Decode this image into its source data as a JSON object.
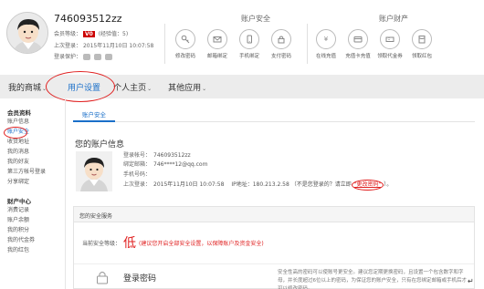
{
  "profile": {
    "username": "746093512zz",
    "level_label": "会员等级：",
    "vip": "V0",
    "exp": "(经验值：5)",
    "last_login_label": "上次登录：",
    "last_login": "2015年11月10日 10:07:58",
    "login_via_label": "登录保护："
  },
  "account_security": {
    "title": "账户安全",
    "items": [
      "修改密码",
      "邮箱绑定",
      "手机绑定",
      "支付密码"
    ]
  },
  "account_assets": {
    "title": "账户财产",
    "items": [
      "在线充值",
      "充值卡充值",
      "领取代金券",
      "领取红包"
    ]
  },
  "nav": {
    "items": [
      {
        "label": "我的商城",
        "caret": "⌄"
      },
      {
        "label": "用户设置",
        "caret": ""
      },
      {
        "label": "个人主页",
        "caret": "⌄"
      },
      {
        "label": "其他应用",
        "caret": "⌄"
      }
    ]
  },
  "sidebar": {
    "group1_title": "会员资料",
    "group1_items": [
      "账户信息",
      "账户安全",
      "收货地址",
      "我的消息",
      "我的好友",
      "第三方帐号登录",
      "分享绑定"
    ],
    "group2_title": "财产中心",
    "group2_items": [
      "消费记录",
      "账户余额",
      "我的积分",
      "我的代金券",
      "我的红包"
    ]
  },
  "main": {
    "tab": "账户安全",
    "info_title": "您的账户信息",
    "lines": {
      "account_label": "登录帐号：",
      "account": "746093512zz",
      "email_label": "绑定邮箱：",
      "email": "746****12@qq.com",
      "phone_label": "手机号码：",
      "phone": "",
      "last_label": "上次登录：",
      "last": "2015年11月10日 10:07:58",
      "ip_label": "IP地址：",
      "ip": "180.213.2.58",
      "warn_pre": "（不是您登录的？请立即",
      "warn_link": "\"更改密码\"",
      "warn_post": "）。"
    },
    "panel_title": "您的安全服务",
    "level_label": "当前安全等级：",
    "level": "低",
    "level_note": "(建议您开启全部安全设置，以保障账户及资金安全)",
    "login_pwd_label": "登录密码",
    "login_pwd_desc": "安全性高的密码可以使账号更安全。建议您定期更换密码，且设置一个包含数字和字母，并长度超过6位以上的密码，为保证您的账户安全，只有在您绑定邮箱或手机后才可以修改密码。"
  },
  "colors": {
    "accent": "#1a6fc9",
    "warn": "#e02020",
    "nav_bg": "#ececec"
  },
  "misc": {
    "return_mark": "↵"
  }
}
